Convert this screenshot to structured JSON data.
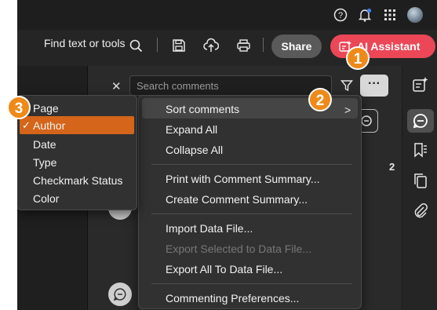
{
  "topbar": {
    "icons": [
      "help-icon",
      "notification-bell-icon",
      "apps-grid-icon",
      "user-avatar"
    ],
    "notification_dot_color": "#3b82f6"
  },
  "toolbar": {
    "find_label": "Find text or tools",
    "share_label": "Share",
    "ai_label": "AI Assistant",
    "ai_color": "#eb4757"
  },
  "comments": {
    "search_placeholder": "Search comments",
    "more_label": "···",
    "count": "2"
  },
  "main_menu": {
    "items": [
      {
        "label": "Sort comments",
        "enabled": true,
        "has_submenu": true
      },
      {
        "label": "Expand All",
        "enabled": true
      },
      {
        "label": "Collapse All",
        "enabled": true
      },
      {
        "label": "Print with Comment Summary...",
        "enabled": true
      },
      {
        "label": "Create Comment Summary...",
        "enabled": true
      },
      {
        "label": "Import Data File...",
        "enabled": true
      },
      {
        "label": "Export Selected to Data File...",
        "enabled": false
      },
      {
        "label": "Export All To Data File...",
        "enabled": true
      },
      {
        "label": "Commenting Preferences...",
        "enabled": true
      }
    ]
  },
  "sort_submenu": {
    "items": [
      "Page",
      "Author",
      "Date",
      "Type",
      "Checkmark Status",
      "Color"
    ],
    "selected": "Author",
    "highlight_color": "#d4651a"
  },
  "callouts": [
    "1",
    "2",
    "3"
  ],
  "callout_color": "#ee8a1a"
}
